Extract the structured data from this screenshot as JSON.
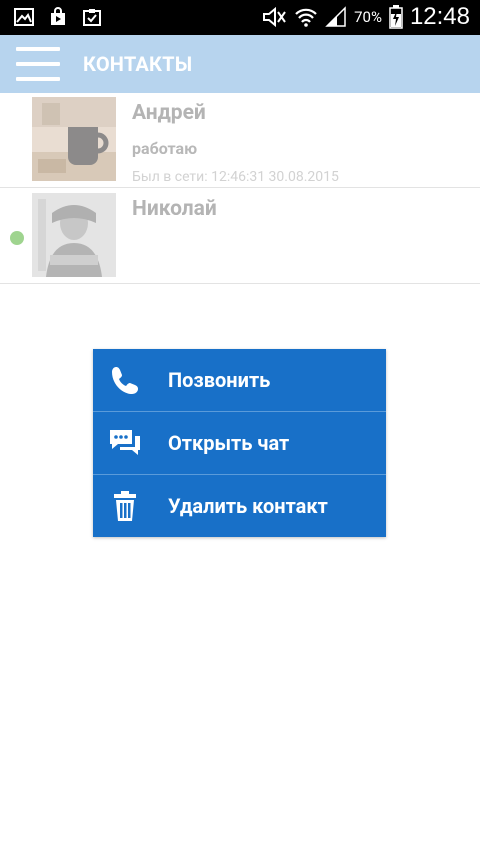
{
  "status_bar": {
    "battery_percent": "70%",
    "time": "12:48",
    "left_icons": [
      "gallery-icon",
      "play-store-icon",
      "clipboard-check-icon"
    ],
    "right_icons": [
      "mute-icon",
      "wifi-icon",
      "signal-icon",
      "battery-icon"
    ]
  },
  "header": {
    "title": "КОНТАКТЫ",
    "bg_color": "#b7d4ee"
  },
  "contacts": [
    {
      "name": "Андрей",
      "status": "работаю",
      "last_seen": "Был в сети: 12:46:31 30.08.2015",
      "online": false
    },
    {
      "name": "Николай",
      "status": "",
      "last_seen": "",
      "online": true
    }
  ],
  "context_menu": {
    "bg_color": "#1870c8",
    "items": [
      {
        "label": "Позвонить",
        "icon": "phone-icon"
      },
      {
        "label": "Открыть чат",
        "icon": "chat-icon"
      },
      {
        "label": "Удалить контакт",
        "icon": "trash-icon"
      }
    ]
  }
}
